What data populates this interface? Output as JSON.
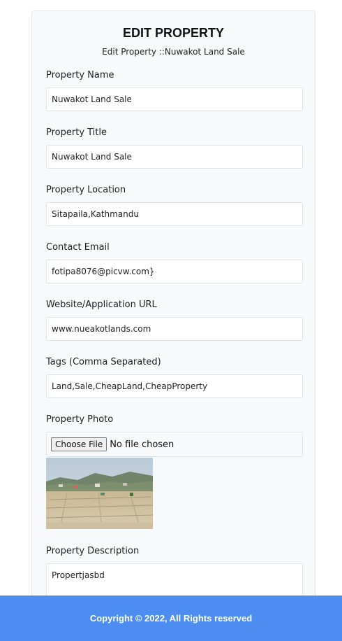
{
  "form": {
    "heading": "EDIT PROPERTY",
    "subheading": "Edit Property ::Nuwakot Land Sale",
    "fields": [
      {
        "label": "Property Name",
        "value": "Nuwakot Land Sale"
      },
      {
        "label": "Property Title",
        "value": "Nuwakot Land Sale"
      },
      {
        "label": "Property Location",
        "value": "Sitapaila,Kathmandu"
      },
      {
        "label": "Contact Email",
        "value": "fotipa8076@picvw.com}"
      },
      {
        "label": "Website/Application URL",
        "value": "www.nueakotlands.com"
      },
      {
        "label": "Tags (Comma Separated)",
        "value": "Land,Sale,CheapLand,CheapProperty"
      }
    ],
    "photo": {
      "label": "Property Photo",
      "button_label": "Choose File",
      "status": "No file chosen"
    },
    "description": {
      "label": "Property Description",
      "value": "Propertjasbd"
    }
  },
  "footer": {
    "text": "Copyright © 2022, All Rights reserved"
  },
  "colors": {
    "footer_bg": "#4d8cf0",
    "card_bg": "#f8f9fa"
  }
}
